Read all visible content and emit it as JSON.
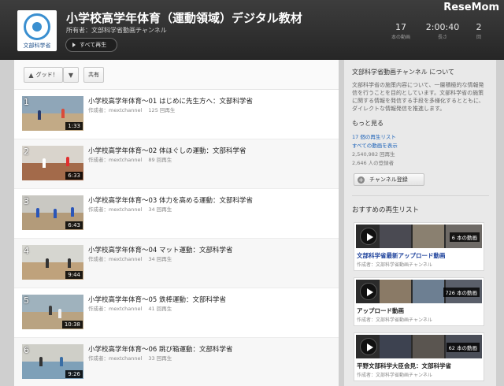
{
  "header": {
    "logo_text": "文部科学省",
    "title": "小学校高学年体育（運動領域）デジタル教材",
    "owner": "所有者：文部科学省動画チャンネル",
    "play_all": "すべて再生",
    "stats": [
      {
        "value": "17",
        "label": "本の動画"
      },
      {
        "value": "2:00:40",
        "label": "長さ"
      },
      {
        "value": "2",
        "label": "回"
      }
    ],
    "brand": "ReseMom"
  },
  "actions": {
    "like": "グッド！",
    "dislike_icon": "thumbs-down-icon",
    "share": "共有"
  },
  "videos": [
    {
      "index": "1",
      "title": "小学校高学年体育～01 はじめに先生方へ：文部科学省",
      "author": "作成者：mextchannel",
      "views": "125 回再生",
      "duration": "1:33",
      "sky": "#8fa6b8",
      "ground": "#c2aa86"
    },
    {
      "index": "2",
      "title": "小学校高学年体育～02 体ほぐしの運動：文部科学省",
      "author": "作成者：mextchannel",
      "views": "89 回再生",
      "duration": "6:33",
      "sky": "#d9d4cc",
      "ground": "#a36a4a"
    },
    {
      "index": "3",
      "title": "小学校高学年体育～03 体力を高める運動：文部科学省",
      "author": "作成者：mextchannel",
      "views": "34 回再生",
      "duration": "6:43",
      "sky": "#c9c8c2",
      "ground": "#b39b7a"
    },
    {
      "index": "4",
      "title": "小学校高学年体育～04 マット運動：文部科学省",
      "author": "作成者：mextchannel",
      "views": "34 回再生",
      "duration": "9:44",
      "sky": "#d6d6d0",
      "ground": "#bfa27c"
    },
    {
      "index": "5",
      "title": "小学校高学年体育～05 鉄棒運動：文部科学省",
      "author": "作成者：mextchannel",
      "views": "41 回再生",
      "duration": "10:38",
      "sky": "#9fb2bd",
      "ground": "#b9a381"
    },
    {
      "index": "6",
      "title": "小学校高学年体育～06 跳び箱運動：文部科学省",
      "author": "作成者：mextchannel",
      "views": "33 回再生",
      "duration": "9:26",
      "sky": "#cfcfc8",
      "ground": "#7ea0b8"
    }
  ],
  "sidebar": {
    "title": "文部科学省動画チャンネル について",
    "description": "文部科学省の施策内容について、一層積極的な情報発信を行うことを目的としています。文部科学省の施策に関する情報を発信する手段を多様化するとともに、ダイレクトな情報発信を推進します。",
    "more_heading": "もっと見る",
    "playlists_link": "17 個の再生リスト",
    "all_videos_link": "すべての動画を表示",
    "total_views": "2,540,982 回再生",
    "subscribers": "2,646 人の登録者",
    "subscribe": "チャンネル登録",
    "recommended_heading": "おすすめの再生リスト",
    "recommended": [
      {
        "title": "文部科学省最新アップロード動画",
        "by": "作成者：文部科学省動画チャンネル",
        "count": "6 本の動画"
      },
      {
        "title": "アップロード動画",
        "by": "作成者：文部科学省動画チャンネル",
        "count": "726 本の動画"
      },
      {
        "title": "平野文部科学大臣会見：文部科学省",
        "by": "作成者：文部科学省動画チャンネル",
        "count": "62 本の動画"
      }
    ]
  }
}
